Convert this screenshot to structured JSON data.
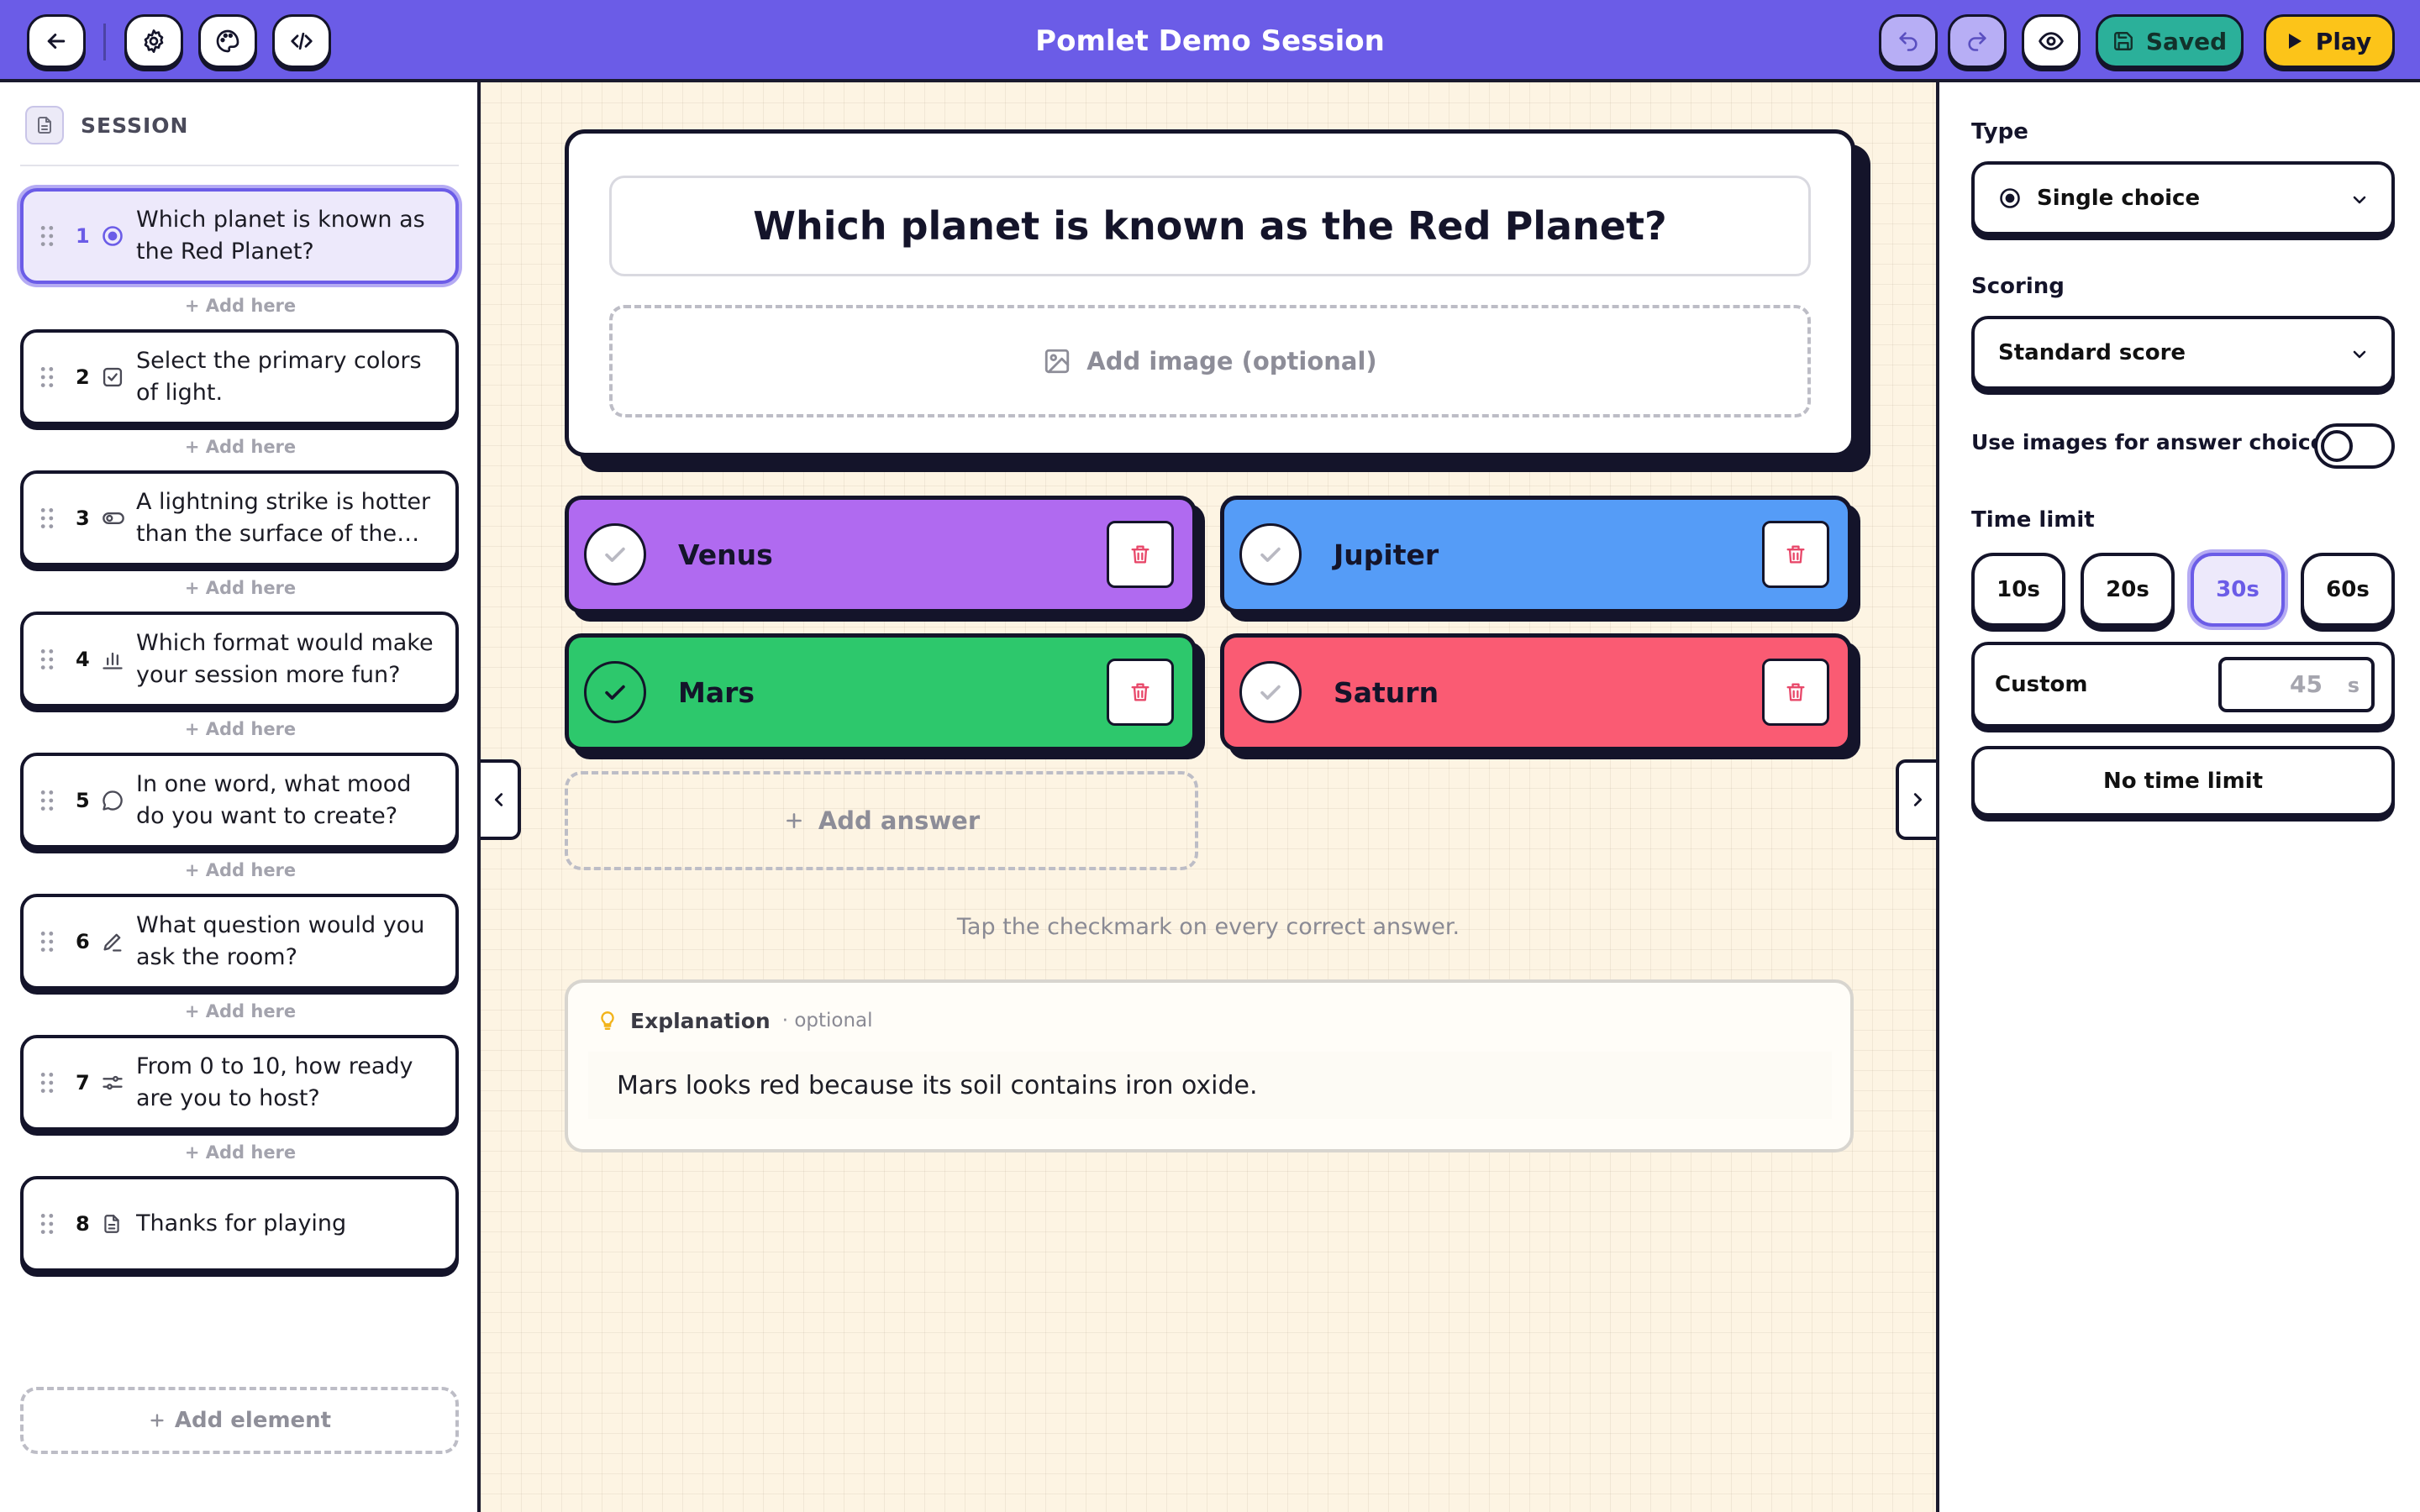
{
  "app": {
    "title": "Pomlet Demo Session"
  },
  "toolbar": {
    "back_icon": "arrow-left-icon",
    "settings_icon": "gear-icon",
    "theme_icon": "palette-icon",
    "embed_icon": "code-icon",
    "undo_icon": "undo-icon",
    "redo_icon": "redo-icon",
    "preview_icon": "eye-icon",
    "saved_label": "Saved",
    "play_label": "Play"
  },
  "sidebar": {
    "header": "SESSION",
    "add_here_label": "+ Add here",
    "add_element_label": "Add element",
    "items": [
      {
        "num": "1",
        "icon": "radio-icon",
        "title": "Which planet is known as the Red Planet?",
        "active": true
      },
      {
        "num": "2",
        "icon": "checkbox-icon",
        "title": "Select the primary colors of light."
      },
      {
        "num": "3",
        "icon": "toggle-icon",
        "title": "A lightning strike is hotter than the surface of the sun."
      },
      {
        "num": "4",
        "icon": "bar-chart-icon",
        "title": "Which format would make your session more fun?"
      },
      {
        "num": "5",
        "icon": "speech-bubble-icon",
        "title": "In one word, what mood do you want to create?"
      },
      {
        "num": "6",
        "icon": "pencil-icon",
        "title": "What question would you ask the room?"
      },
      {
        "num": "7",
        "icon": "sliders-icon",
        "title": "From 0 to 10, how ready are you to host?"
      },
      {
        "num": "8",
        "icon": "document-icon",
        "title": "Thanks for playing"
      }
    ]
  },
  "editor": {
    "question": "Which planet is known as the Red Planet?",
    "add_image_label": "Add image (optional)",
    "answers": [
      {
        "text": "Venus",
        "color": "#b06af0",
        "correct": false
      },
      {
        "text": "Jupiter",
        "color": "#559cf7",
        "correct": false
      },
      {
        "text": "Mars",
        "color": "#2dc86c",
        "correct": true
      },
      {
        "text": "Saturn",
        "color": "#fa5b73",
        "correct": false
      }
    ],
    "add_answer_label": "Add answer",
    "hint": "Tap the checkmark on every correct answer.",
    "explanation": {
      "title": "Explanation",
      "optional": "· optional",
      "text": "Mars looks red because its soil contains iron oxide."
    }
  },
  "settings": {
    "type_label": "Type",
    "type_value": "Single choice",
    "scoring_label": "Scoring",
    "scoring_value": "Standard score",
    "images_toggle_label": "Use images for answer choices",
    "images_toggle_on": false,
    "time_limit_label": "Time limit",
    "time_options": [
      "10s",
      "20s",
      "30s",
      "60s"
    ],
    "time_selected": "30s",
    "custom_label": "Custom",
    "custom_placeholder": "45",
    "custom_unit": "s",
    "no_limit_label": "No time limit"
  }
}
